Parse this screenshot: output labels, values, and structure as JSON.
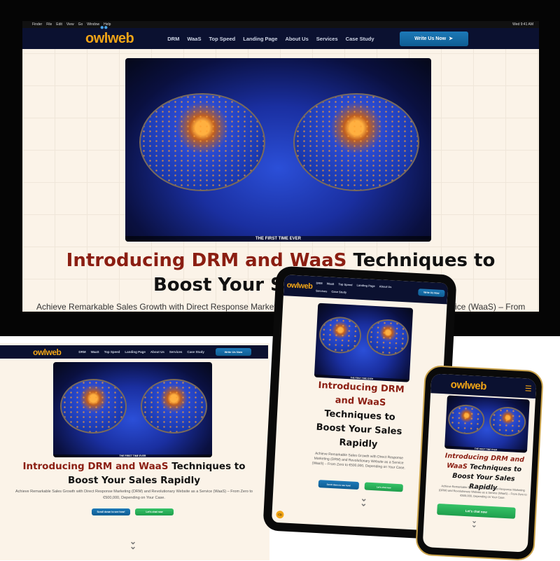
{
  "menubar": {
    "items": [
      "Finder",
      "File",
      "Edit",
      "View",
      "Go",
      "Window",
      "Help"
    ],
    "clock": "Wed 9:41 AM"
  },
  "site": {
    "logo": "owlweb",
    "nav": [
      "DRM",
      "WaaS",
      "Top Speed",
      "Landing Page",
      "About Us",
      "Services",
      "Case Study"
    ],
    "cta": "Write Us Now",
    "hero_caption": "THE FIRST TIME EVER",
    "headline_red": "Introducing DRM and WaaS",
    "headline_black": "Techniques to Boost Your Sales Rapidly",
    "subtitle": "Achieve Remarkable Sales Growth with Direct Response Marketing (DRM) and Revolutionary Website as a Service (WaaS) – From Zero to €500,000, Depending on Your Case.",
    "scroll_button": "Scroll down to see how!",
    "chat_button": "Let's chat now",
    "chat_badge": "CB"
  },
  "colors": {
    "nav_bg": "#0b1130",
    "accent_red": "#8b1e12",
    "logo_orange": "#f2a516",
    "button_blue": "#1d79b8",
    "button_green": "#2bb35a",
    "page_bg": "#fbf3e8"
  },
  "icons": {
    "send": "paper-plane-icon",
    "chat": "whatsapp-icon",
    "chevrons": "double-chevron-down-icon",
    "menu": "hamburger-menu-icon"
  }
}
